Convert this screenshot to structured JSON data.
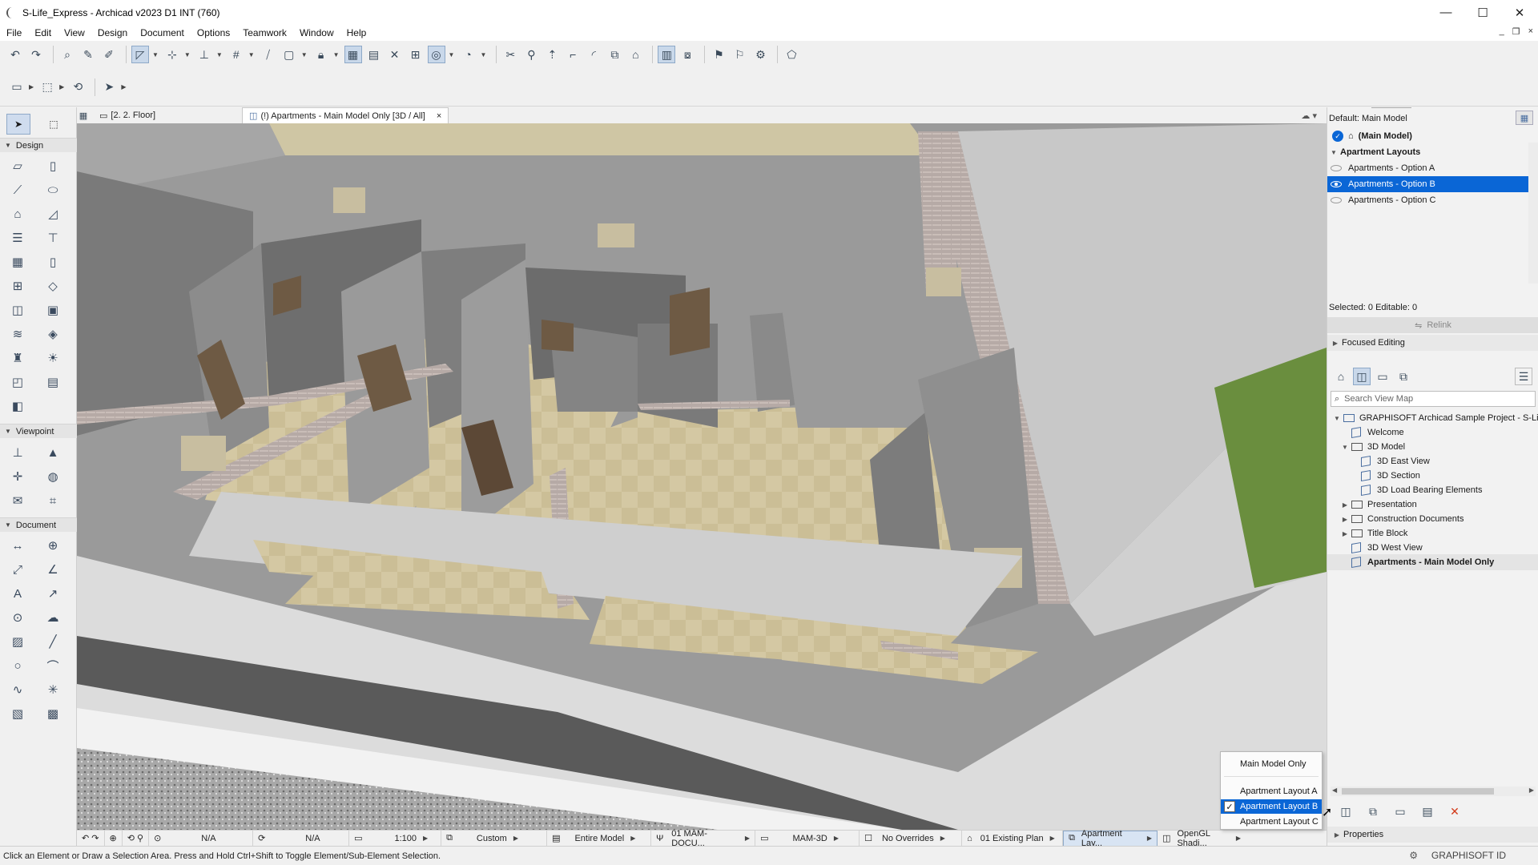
{
  "window": {
    "title": "S-Life_Express - Archicad v2023 D1 INT (760)",
    "minimize": "—",
    "maximize": "☐",
    "close": "✕"
  },
  "menu": [
    "File",
    "Edit",
    "View",
    "Design",
    "Document",
    "Options",
    "Teamwork",
    "Window",
    "Help"
  ],
  "toolbox": {
    "sections": [
      "Design",
      "Viewpoint",
      "Document"
    ]
  },
  "tabs": {
    "floor_tab": "[2. 2. Floor]",
    "active_tab": "(!) Apartments - Main Model Only [3D / All]",
    "close": "×"
  },
  "navigator": {
    "default_label": "Default: Main Model",
    "main_model": "(Main Model)",
    "group_label": "Apartment Layouts",
    "options": [
      "Apartments - Option A",
      "Apartments - Option B",
      "Apartments - Option C"
    ],
    "selected_info": "Selected: 0 Editable: 0",
    "relink_label": "Relink",
    "focused_editing": "Focused Editing",
    "search_placeholder": "Search View Map",
    "tree": {
      "root": "GRAPHISOFT Archicad Sample Project - S-Li",
      "welcome": "Welcome",
      "model_folder": "3D Model",
      "east_view": "3D East View",
      "section": "3D Section",
      "load_bearing": "3D Load Bearing Elements",
      "presentation": "Presentation",
      "construction_docs": "Construction Documents",
      "title_block": "Title Block",
      "west_view": "3D West View",
      "main_model_only": "Apartments - Main Model Only"
    },
    "properties_label": "Properties"
  },
  "viewctrl": {
    "na1": "N/A",
    "na2": "N/A",
    "scale": "1:100",
    "custom": "Custom",
    "entire_model": "Entire Model",
    "layer_combo": "01 MAM-DOCU...",
    "model_view": "MAM-3D",
    "overrides": "No Overrides",
    "renovation": "01 Existing Plan",
    "design_option": "Apartment Lay...",
    "engine": "OpenGL Shadi..."
  },
  "popup": {
    "main_model_only": "Main Model Only",
    "layout_a": "Apartment Layout A",
    "layout_b": "Apartment Layout B",
    "layout_c": "Apartment Layout C",
    "check": "✓"
  },
  "status": {
    "message": "Click an Element or Draw a Selection Area. Press and Hold Ctrl+Shift to Toggle Element/Sub-Element Selection.",
    "brand": "GRAPHISOFT ID"
  },
  "colors": {
    "selection_blue": "#0a66d6",
    "floor_tile": "#cfc29c",
    "wall_grey": "#8e8e8e"
  }
}
